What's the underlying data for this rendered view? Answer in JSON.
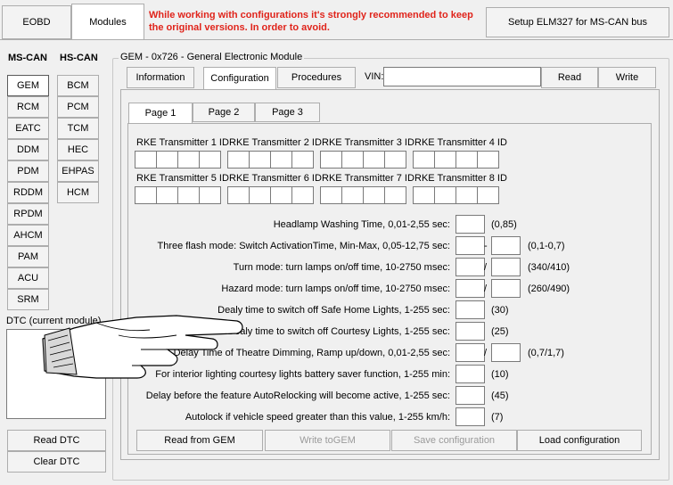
{
  "top": {
    "eobd_tab": "EOBD",
    "modules_tab": "Modules",
    "warning": "While working with configurations it's strongly recommended to keep the original versions. In order to avoid.",
    "setup_button": "Setup ELM327 for MS-CAN bus"
  },
  "left": {
    "ms_can_header": "MS-CAN",
    "hs_can_header": "HS-CAN",
    "ms_can_modules": [
      "GEM",
      "RCM",
      "EATC",
      "DDM",
      "PDM",
      "RDDM",
      "RPDM",
      "AHCM",
      "PAM",
      "ACU",
      "SRM"
    ],
    "hs_can_modules": [
      "BCM",
      "PCM",
      "TCM",
      "HEC",
      "EHPAS",
      "HCM"
    ],
    "dtc_label": "DTC (current module)",
    "read_dtc": "Read DTC",
    "clear_dtc": "Clear DTC"
  },
  "gem": {
    "group_title": "GEM - 0x726 - General Electronic Module",
    "tabs": [
      "Information",
      "Configuration",
      "Procedures"
    ],
    "vin_label": "VIN:",
    "vin_value": "",
    "read_button": "Read",
    "write_button": "Write"
  },
  "pages": [
    "Page 1",
    "Page 2",
    "Page 3"
  ],
  "rke": [
    "RKE Transmitter 1 ID",
    "RKE Transmitter 2 ID",
    "RKE Transmitter 3 ID",
    "RKE Transmitter 4 ID",
    "RKE Transmitter 5 ID",
    "RKE Transmitter 6 ID",
    "RKE Transmitter 7 ID",
    "RKE Transmitter 8 ID"
  ],
  "params": [
    {
      "label": "Headlamp Washing Time, 0,01-2,55 sec:",
      "range": "(0,85)",
      "fields": 1
    },
    {
      "label": "Three flash mode: Switch ActivationTime, Min-Max, 0,05-12,75 sec:",
      "sep": "-",
      "range": "(0,1-0,7)",
      "fields": 2
    },
    {
      "label": "Turn mode: turn lamps on/off time, 10-2750 msec:",
      "sep": "/",
      "range": "(340/410)",
      "fields": 2
    },
    {
      "label": "Hazard mode: turn lamps on/off time, 10-2750 msec:",
      "sep": "/",
      "range": "(260/490)",
      "fields": 2
    },
    {
      "label": "Dealy time to switch off Safe Home Lights, 1-255 sec:",
      "range": "(30)",
      "fields": 1
    },
    {
      "label": "Dealy time to switch off Courtesy Lights, 1-255 sec:",
      "range": "(25)",
      "fields": 1
    },
    {
      "label": "Delay Time of Theatre Dimming, Ramp up/down, 0,01-2,55 sec:",
      "sep": "/",
      "range": "(0,7/1,7)",
      "fields": 2
    },
    {
      "label": "For interior lighting courtesy lights battery saver function, 1-255 min:",
      "range": "(10)",
      "fields": 1
    },
    {
      "label": "Delay before the feature AutoRelocking will become active, 1-255 sec:",
      "range": "(45)",
      "fields": 1
    },
    {
      "label": "Autolock if vehicle speed greater than this value, 1-255 km/h:",
      "range": "(7)",
      "fields": 1
    }
  ],
  "bottom": {
    "read_from_gem": "Read from GEM",
    "write_to_gem": "Write toGEM",
    "save_config": "Save configuration",
    "load_config": "Load configuration"
  },
  "colors": {
    "warning": "#e0241b",
    "background": "#f0f0f0"
  },
  "icons": {
    "pointer": "pointing-hand-icon"
  }
}
